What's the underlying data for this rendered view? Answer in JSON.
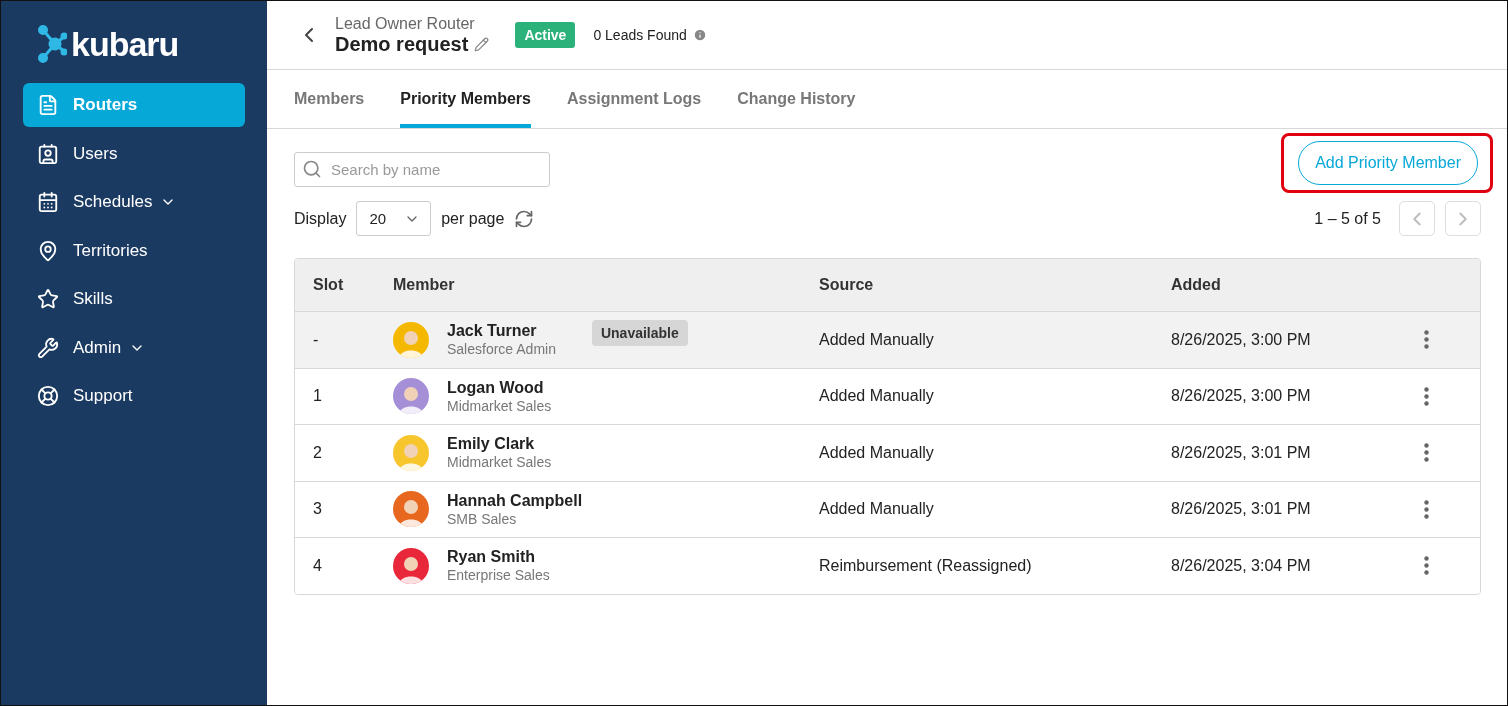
{
  "brand": {
    "name": "kubaru"
  },
  "sidebar": {
    "items": [
      {
        "label": "Routers",
        "selected": true,
        "expandable": false
      },
      {
        "label": "Users",
        "selected": false,
        "expandable": false
      },
      {
        "label": "Schedules",
        "selected": false,
        "expandable": true
      },
      {
        "label": "Territories",
        "selected": false,
        "expandable": false
      },
      {
        "label": "Skills",
        "selected": false,
        "expandable": false
      },
      {
        "label": "Admin",
        "selected": false,
        "expandable": true
      },
      {
        "label": "Support",
        "selected": false,
        "expandable": false
      }
    ]
  },
  "header": {
    "breadcrumb": "Lead Owner Router",
    "title": "Demo request",
    "status": "Active",
    "leads_found": "0 Leads Found"
  },
  "tabs": [
    {
      "label": "Members",
      "selected": false
    },
    {
      "label": "Priority Members",
      "selected": true
    },
    {
      "label": "Assignment Logs",
      "selected": false
    },
    {
      "label": "Change History",
      "selected": false
    }
  ],
  "search": {
    "placeholder": "Search by name"
  },
  "add_button": {
    "label": "Add Priority Member",
    "highlighted": true
  },
  "pagination": {
    "display_label": "Display",
    "page_size": "20",
    "per_page_label": "per page",
    "range": "1 – 5 of 5"
  },
  "table": {
    "columns": [
      "Slot",
      "Member",
      "Source",
      "Added"
    ],
    "rows": [
      {
        "slot": "-",
        "name": "Jack Turner",
        "role": "Salesforce Admin",
        "badge": "Unavailable",
        "unavailable": true,
        "source": "Added Manually",
        "added": "8/26/2025, 3:00 PM"
      },
      {
        "slot": "1",
        "name": "Logan Wood",
        "role": "Midmarket Sales",
        "unavailable": false,
        "source": "Added Manually",
        "added": "8/26/2025, 3:00 PM"
      },
      {
        "slot": "2",
        "name": "Emily Clark",
        "role": "Midmarket Sales",
        "unavailable": false,
        "source": "Added Manually",
        "added": "8/26/2025, 3:01 PM"
      },
      {
        "slot": "3",
        "name": "Hannah Campbell",
        "role": "SMB Sales",
        "unavailable": false,
        "source": "Added Manually",
        "added": "8/26/2025, 3:01 PM"
      },
      {
        "slot": "4",
        "name": "Ryan Smith",
        "role": "Enterprise Sales",
        "unavailable": false,
        "source": "Reimbursement (Reassigned)",
        "added": "8/26/2025, 3:04 PM"
      }
    ]
  }
}
